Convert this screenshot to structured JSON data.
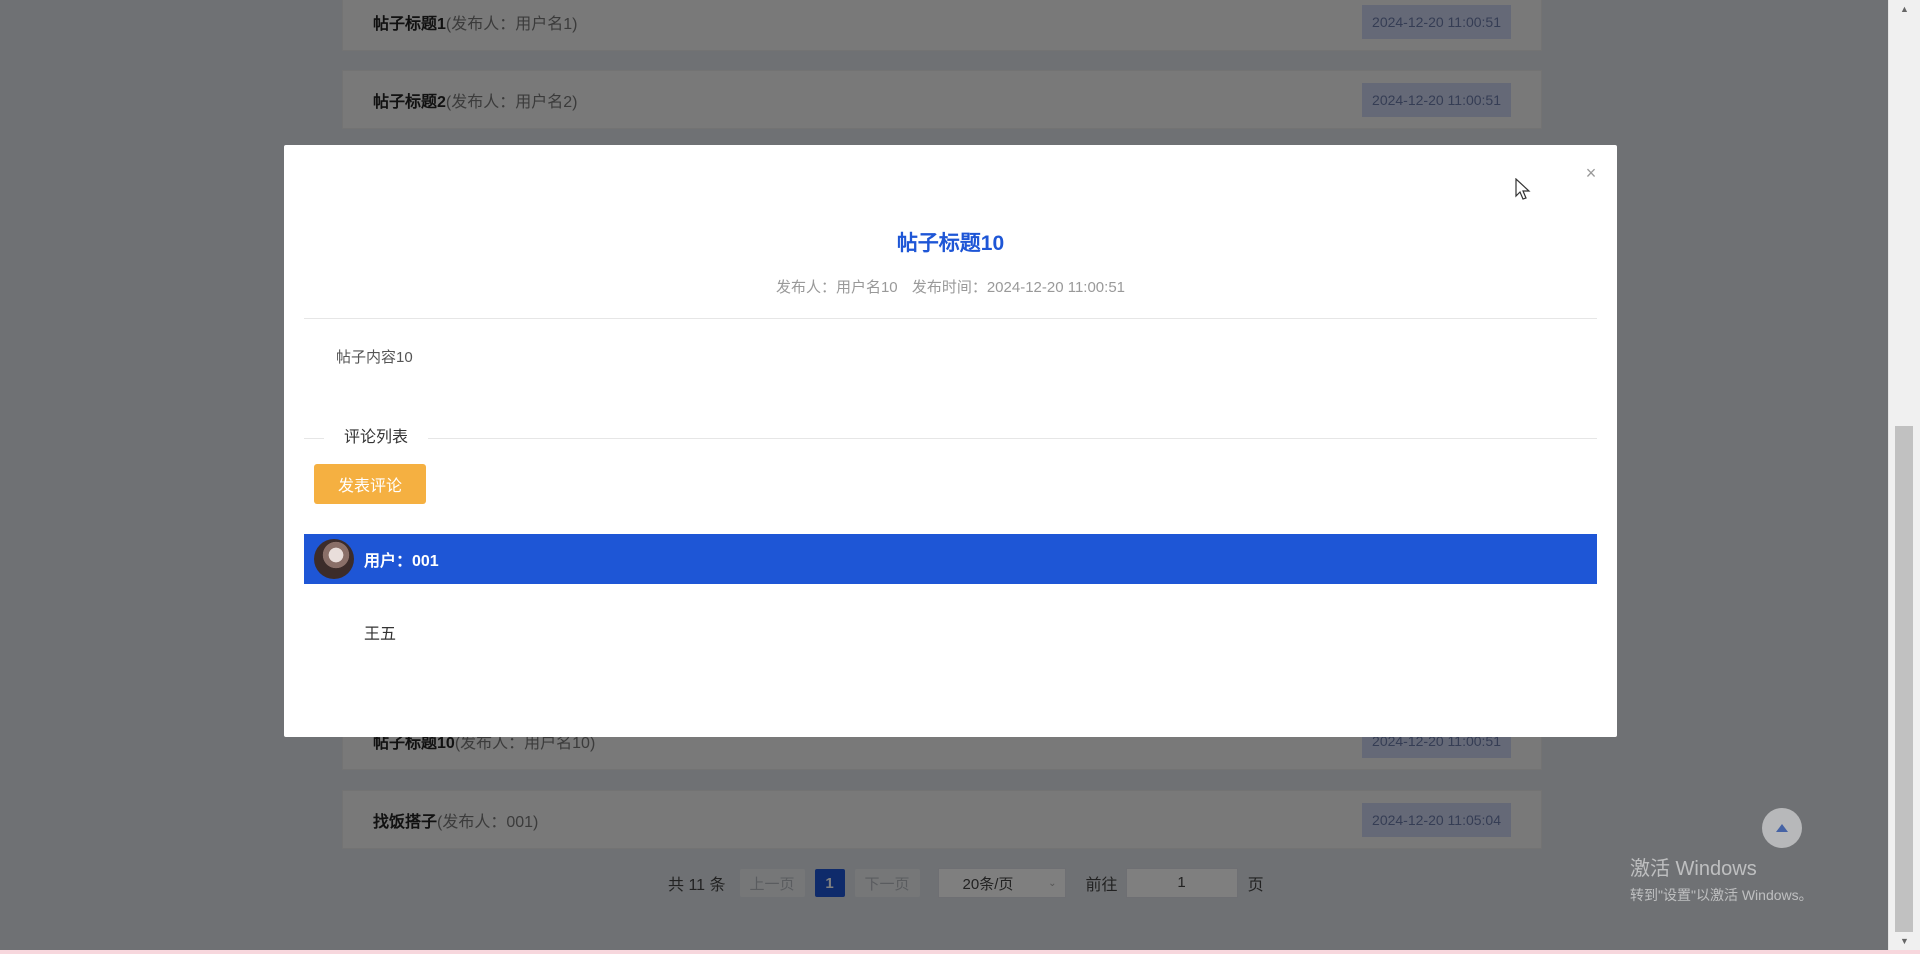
{
  "posts": [
    {
      "title": "帖子标题1",
      "author": "(发布人：用户名1)",
      "time": "2024-12-20 11:00:51"
    },
    {
      "title": "帖子标题2",
      "author": "(发布人：用户名2)",
      "time": "2024-12-20 11:00:51"
    },
    {
      "title": "帖子标题10",
      "author": "(发布人：用户名10)",
      "time": "2024-12-20 11:00:51"
    },
    {
      "title": "找饭搭子",
      "author": "(发布人：001)",
      "time": "2024-12-20 11:05:04"
    }
  ],
  "pagination": {
    "total": "共 11 条",
    "prev": "上一页",
    "current": "1",
    "next": "下一页",
    "page_size": "20条/页",
    "goto_label": "前往",
    "goto_value": "1",
    "page_suffix": "页"
  },
  "dialog": {
    "title": "帖子标题10",
    "author_meta": "发布人：用户名10",
    "time_meta": "发布时间：2024-12-20 11:00:51",
    "content": "帖子内容10",
    "comments_heading": "评论列表",
    "comment_button": "发表评论",
    "close_symbol": "×",
    "comments": [
      {
        "user": "用户：001",
        "text": "王五"
      }
    ]
  },
  "watermark": {
    "title": "激活 Windows",
    "subtitle": "转到\"设置\"以激活 Windows。"
  },
  "colors": {
    "accent": "#1e56d6",
    "button": "#f5b041"
  },
  "icons": {
    "close": "close-icon",
    "back_to_top": "arrow-up-icon",
    "dropdown": "chevron-down-icon",
    "avatar": "avatar"
  }
}
